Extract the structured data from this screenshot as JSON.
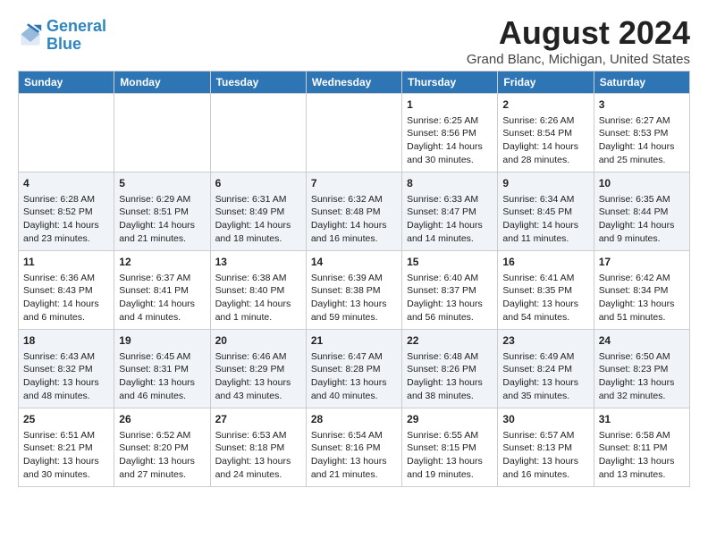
{
  "logo": {
    "line1": "General",
    "line2": "Blue"
  },
  "title": "August 2024",
  "subtitle": "Grand Blanc, Michigan, United States",
  "days_of_week": [
    "Sunday",
    "Monday",
    "Tuesday",
    "Wednesday",
    "Thursday",
    "Friday",
    "Saturday"
  ],
  "weeks": [
    [
      {
        "day": "",
        "content": ""
      },
      {
        "day": "",
        "content": ""
      },
      {
        "day": "",
        "content": ""
      },
      {
        "day": "",
        "content": ""
      },
      {
        "day": "1",
        "content": "Sunrise: 6:25 AM\nSunset: 8:56 PM\nDaylight: 14 hours and 30 minutes."
      },
      {
        "day": "2",
        "content": "Sunrise: 6:26 AM\nSunset: 8:54 PM\nDaylight: 14 hours and 28 minutes."
      },
      {
        "day": "3",
        "content": "Sunrise: 6:27 AM\nSunset: 8:53 PM\nDaylight: 14 hours and 25 minutes."
      }
    ],
    [
      {
        "day": "4",
        "content": "Sunrise: 6:28 AM\nSunset: 8:52 PM\nDaylight: 14 hours and 23 minutes."
      },
      {
        "day": "5",
        "content": "Sunrise: 6:29 AM\nSunset: 8:51 PM\nDaylight: 14 hours and 21 minutes."
      },
      {
        "day": "6",
        "content": "Sunrise: 6:31 AM\nSunset: 8:49 PM\nDaylight: 14 hours and 18 minutes."
      },
      {
        "day": "7",
        "content": "Sunrise: 6:32 AM\nSunset: 8:48 PM\nDaylight: 14 hours and 16 minutes."
      },
      {
        "day": "8",
        "content": "Sunrise: 6:33 AM\nSunset: 8:47 PM\nDaylight: 14 hours and 14 minutes."
      },
      {
        "day": "9",
        "content": "Sunrise: 6:34 AM\nSunset: 8:45 PM\nDaylight: 14 hours and 11 minutes."
      },
      {
        "day": "10",
        "content": "Sunrise: 6:35 AM\nSunset: 8:44 PM\nDaylight: 14 hours and 9 minutes."
      }
    ],
    [
      {
        "day": "11",
        "content": "Sunrise: 6:36 AM\nSunset: 8:43 PM\nDaylight: 14 hours and 6 minutes."
      },
      {
        "day": "12",
        "content": "Sunrise: 6:37 AM\nSunset: 8:41 PM\nDaylight: 14 hours and 4 minutes."
      },
      {
        "day": "13",
        "content": "Sunrise: 6:38 AM\nSunset: 8:40 PM\nDaylight: 14 hours and 1 minute."
      },
      {
        "day": "14",
        "content": "Sunrise: 6:39 AM\nSunset: 8:38 PM\nDaylight: 13 hours and 59 minutes."
      },
      {
        "day": "15",
        "content": "Sunrise: 6:40 AM\nSunset: 8:37 PM\nDaylight: 13 hours and 56 minutes."
      },
      {
        "day": "16",
        "content": "Sunrise: 6:41 AM\nSunset: 8:35 PM\nDaylight: 13 hours and 54 minutes."
      },
      {
        "day": "17",
        "content": "Sunrise: 6:42 AM\nSunset: 8:34 PM\nDaylight: 13 hours and 51 minutes."
      }
    ],
    [
      {
        "day": "18",
        "content": "Sunrise: 6:43 AM\nSunset: 8:32 PM\nDaylight: 13 hours and 48 minutes."
      },
      {
        "day": "19",
        "content": "Sunrise: 6:45 AM\nSunset: 8:31 PM\nDaylight: 13 hours and 46 minutes."
      },
      {
        "day": "20",
        "content": "Sunrise: 6:46 AM\nSunset: 8:29 PM\nDaylight: 13 hours and 43 minutes."
      },
      {
        "day": "21",
        "content": "Sunrise: 6:47 AM\nSunset: 8:28 PM\nDaylight: 13 hours and 40 minutes."
      },
      {
        "day": "22",
        "content": "Sunrise: 6:48 AM\nSunset: 8:26 PM\nDaylight: 13 hours and 38 minutes."
      },
      {
        "day": "23",
        "content": "Sunrise: 6:49 AM\nSunset: 8:24 PM\nDaylight: 13 hours and 35 minutes."
      },
      {
        "day": "24",
        "content": "Sunrise: 6:50 AM\nSunset: 8:23 PM\nDaylight: 13 hours and 32 minutes."
      }
    ],
    [
      {
        "day": "25",
        "content": "Sunrise: 6:51 AM\nSunset: 8:21 PM\nDaylight: 13 hours and 30 minutes."
      },
      {
        "day": "26",
        "content": "Sunrise: 6:52 AM\nSunset: 8:20 PM\nDaylight: 13 hours and 27 minutes."
      },
      {
        "day": "27",
        "content": "Sunrise: 6:53 AM\nSunset: 8:18 PM\nDaylight: 13 hours and 24 minutes."
      },
      {
        "day": "28",
        "content": "Sunrise: 6:54 AM\nSunset: 8:16 PM\nDaylight: 13 hours and 21 minutes."
      },
      {
        "day": "29",
        "content": "Sunrise: 6:55 AM\nSunset: 8:15 PM\nDaylight: 13 hours and 19 minutes."
      },
      {
        "day": "30",
        "content": "Sunrise: 6:57 AM\nSunset: 8:13 PM\nDaylight: 13 hours and 16 minutes."
      },
      {
        "day": "31",
        "content": "Sunrise: 6:58 AM\nSunset: 8:11 PM\nDaylight: 13 hours and 13 minutes."
      }
    ]
  ]
}
